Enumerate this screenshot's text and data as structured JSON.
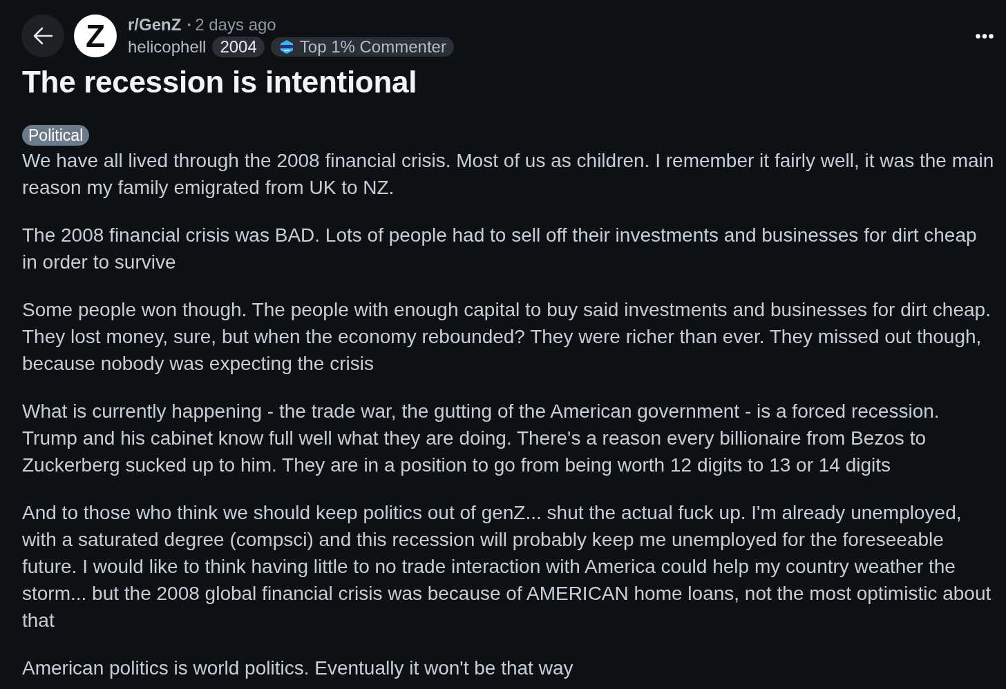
{
  "header": {
    "avatar_letter": "Z",
    "community": "r/GenZ",
    "separator": "•",
    "time": "2 days ago",
    "author": "helicophell",
    "user_flair": "2004",
    "badge": "Top 1% Commenter"
  },
  "title": "The recession is intentional",
  "post_flair": "Political",
  "paragraphs": [
    "We have all lived through the 2008 financial crisis. Most of us as children. I remember it fairly well, it was the main reason my family emigrated from UK to NZ.",
    "The 2008 financial crisis was BAD. Lots of people had to sell off their investments and businesses for dirt cheap in order to survive",
    "Some people won though. The people with enough capital to buy said investments and businesses for dirt cheap. They lost money, sure, but when the economy rebounded? They were richer than ever. They missed out though, because nobody was expecting the crisis",
    "What is currently happening - the trade war, the gutting of the American government - is a forced recession. Trump and his cabinet know full well what they are doing. There's a reason every billionaire from Bezos to Zuckerberg sucked up to him. They are in a position to go from being worth 12 digits to 13 or 14 digits",
    "And to those who think we should keep politics out of genZ... shut the actual fuck up. I'm already unemployed, with a saturated degree (compsci) and this recession will probably keep me unemployed for the foreseeable future. I would like to think having little to no trade interaction with America could help my country weather the storm... but the 2008 global financial crisis was because of AMERICAN home loans, not the most optimistic about that",
    "American politics is world politics. Eventually it won't be that way"
  ]
}
